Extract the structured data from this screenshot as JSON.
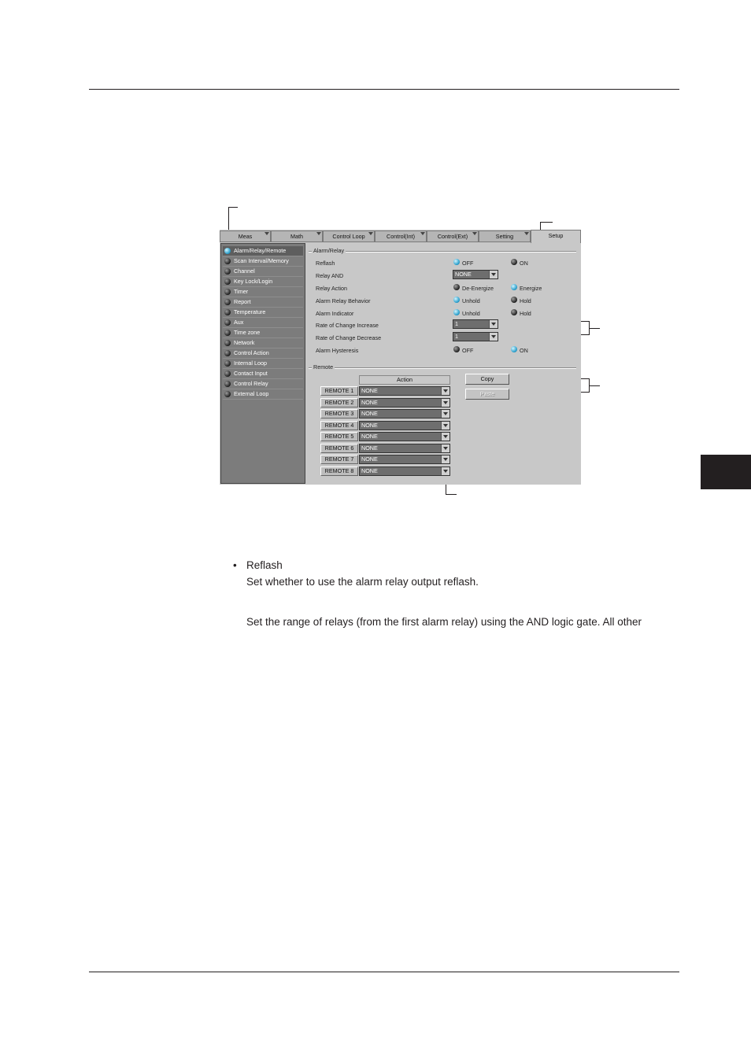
{
  "tabs": [
    "Meas",
    "Math",
    "Control Loop",
    "Control(Int)",
    "Control(Ext)",
    "Setting",
    "Setup"
  ],
  "active_tab": "Setup",
  "nav_items": [
    "Alarm/Relay/Remote",
    "Scan Interval/Memory",
    "Channel",
    "Key Lock/Login",
    "Timer",
    "Report",
    "Temperature",
    "Aux",
    "Time zone",
    "Network",
    "Control Action",
    "Internal Loop",
    "Contact Input",
    "Control Relay",
    "External Loop"
  ],
  "alarm_relay": {
    "title": "Alarm/Relay",
    "reflash": {
      "label": "Reflash",
      "opt1": "OFF",
      "opt2": "ON",
      "selected": "OFF"
    },
    "relay_and": {
      "label": "Relay AND",
      "value": "NONE"
    },
    "relay_action": {
      "label": "Relay Action",
      "opt1": "De-Energize",
      "opt2": "Energize",
      "selected": "Energize"
    },
    "behavior": {
      "label": "Alarm Relay Behavior",
      "opt1": "Unhold",
      "opt2": "Hold",
      "selected": "Unhold"
    },
    "indicator": {
      "label": "Alarm Indicator",
      "opt1": "Unhold",
      "opt2": "Hold",
      "selected": "Unhold"
    },
    "roc_increase": {
      "label": "Rate of Change Increase",
      "value": "1"
    },
    "roc_decrease": {
      "label": "Rate of Change Decrease",
      "value": "1"
    },
    "hysteresis": {
      "label": "Alarm Hysteresis",
      "opt1": "OFF",
      "opt2": "ON",
      "selected": "ON"
    }
  },
  "remote": {
    "title": "Remote",
    "action_header": "Action",
    "rows": [
      {
        "label": "REMOTE 1",
        "value": "NONE"
      },
      {
        "label": "REMOTE 2",
        "value": "NONE"
      },
      {
        "label": "REMOTE 3",
        "value": "NONE"
      },
      {
        "label": "REMOTE 4",
        "value": "NONE"
      },
      {
        "label": "REMOTE 5",
        "value": "NONE"
      },
      {
        "label": "REMOTE 6",
        "value": "NONE"
      },
      {
        "label": "REMOTE 7",
        "value": "NONE"
      },
      {
        "label": "REMOTE 8",
        "value": "NONE"
      }
    ],
    "copy_label": "Copy",
    "paste_label": "Paste"
  },
  "body": {
    "bullet": "•",
    "item_title": "Reflash",
    "item_desc": "Set whether to use the alarm relay output reflash.",
    "para": "Set the range of relays (from the first alarm relay) using the AND logic gate.  All other"
  }
}
